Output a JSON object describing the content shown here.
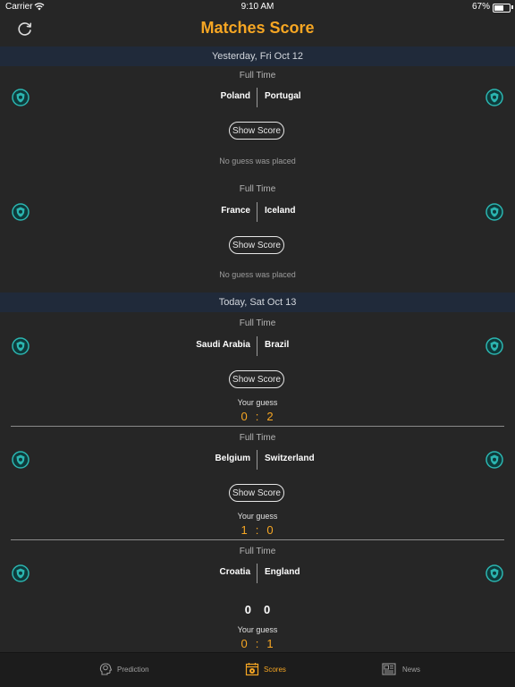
{
  "status_bar": {
    "carrier": "Carrier",
    "time": "9:10 AM",
    "battery": "67%"
  },
  "header": {
    "title": "Matches Score",
    "refresh_icon": "refresh-icon"
  },
  "sections": [
    {
      "title": "Yesterday, Fri Oct 12",
      "matches": [
        {
          "status": "Full Time",
          "home": "Poland",
          "away": "Portugal",
          "button": "Show Score",
          "guess_text": "No guess was placed"
        },
        {
          "status": "Full Time",
          "home": "France",
          "away": "Iceland",
          "button": "Show Score",
          "guess_text": "No guess was placed"
        }
      ]
    },
    {
      "title": "Today, Sat Oct 13",
      "matches": [
        {
          "status": "Full Time",
          "home": "Saudi Arabia",
          "away": "Brazil",
          "button": "Show Score",
          "guess_label": "Your guess",
          "guess_home": "0",
          "guess_sep": ":",
          "guess_away": "2"
        },
        {
          "status": "Full Time",
          "home": "Belgium",
          "away": "Switzerland",
          "button": "Show Score",
          "guess_label": "Your guess",
          "guess_home": "1",
          "guess_sep": ":",
          "guess_away": "0"
        },
        {
          "status": "Full Time",
          "home": "Croatia",
          "away": "England",
          "score_home": "0",
          "score_away": "0",
          "guess_label": "Your guess",
          "guess_home": "0",
          "guess_sep": ":",
          "guess_away": "1"
        }
      ]
    }
  ],
  "tabs": [
    {
      "label": "Prediction",
      "icon": "head-brain-icon",
      "active": false
    },
    {
      "label": "Scores",
      "icon": "calendar-ball-icon",
      "active": true
    },
    {
      "label": "News",
      "icon": "newspaper-icon",
      "active": false
    }
  ],
  "colors": {
    "accent": "#f6a623",
    "background": "#262626",
    "section_header": "#202a3a",
    "crest": "#2bb5b0"
  }
}
